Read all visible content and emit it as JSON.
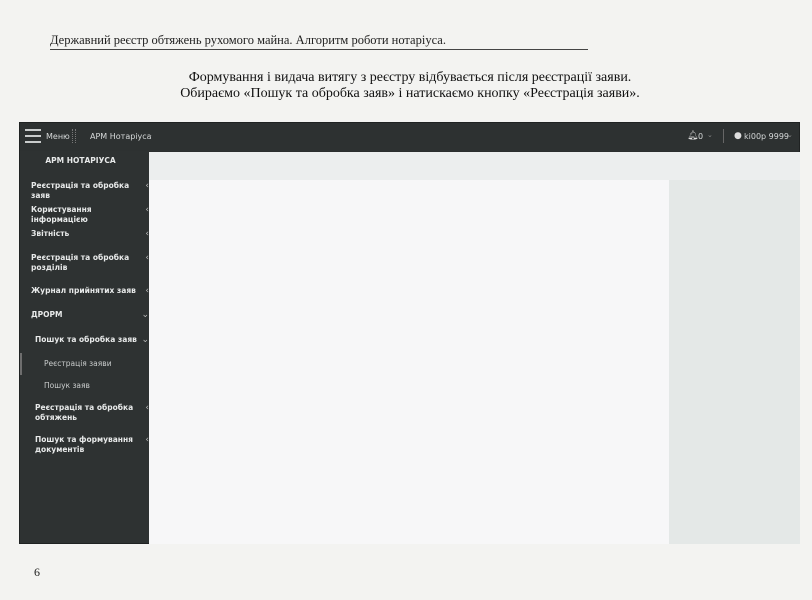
{
  "document": {
    "header": "Державний реєстр обтяжень рухомого майна. Алгоритм роботи нотаріуса.",
    "intro_line1": "Формування і видача витягу з реєстру відбувається після реєстрації заяви.",
    "intro_line2": "Обираємо «Пошук та обробка заяв» і натискаємо кнопку «Реєстрація заяви».",
    "page_number": "6"
  },
  "app": {
    "topbar": {
      "menu_label": "Меню",
      "workspace_label": "АРМ Нотаріуса",
      "notifications_count": "0",
      "user_name": "ki00p 9999"
    },
    "sidebar": {
      "title": "АРМ НОТАРІУСА",
      "items": [
        {
          "label": "Реєстрація та обробка заяв"
        },
        {
          "label": "Користування інформацією"
        },
        {
          "label": "Звітність"
        },
        {
          "label": "Реєстрація та обробка розділів"
        },
        {
          "label": "Журнал прийнятих заяв"
        },
        {
          "label": "ДРОРМ"
        }
      ],
      "subitems": [
        {
          "label": "Пошук та обробка заяв"
        },
        {
          "label": "Реєстрація та обробка обтяжень"
        },
        {
          "label": "Пошук та формування документів"
        }
      ],
      "leaves": [
        {
          "label": "Реєстрація заяви"
        },
        {
          "label": "Пошук заяв"
        }
      ]
    }
  }
}
